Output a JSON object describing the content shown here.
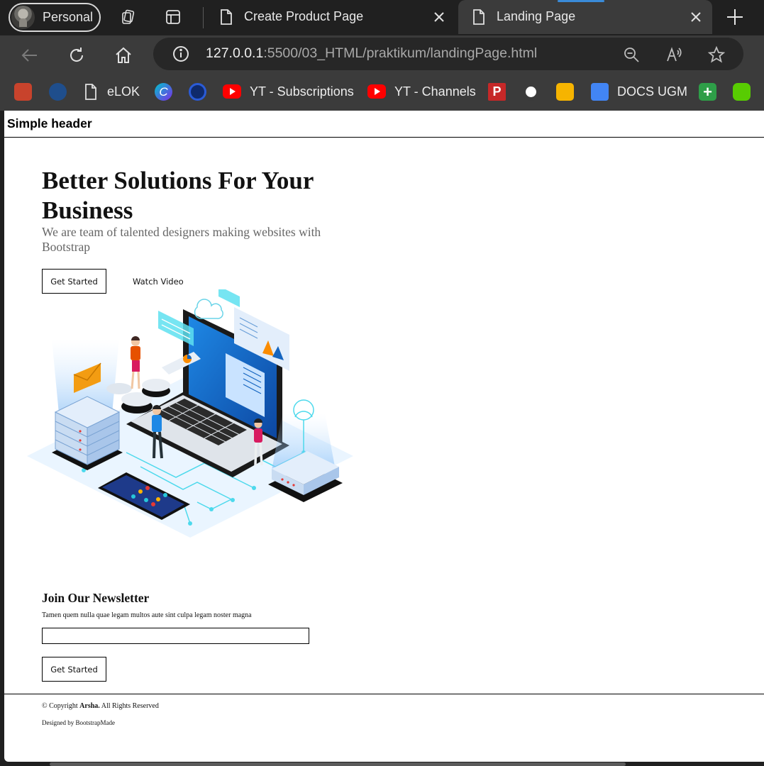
{
  "browser": {
    "profile_label": "Personal",
    "tabs": [
      {
        "title": "Create Product Page",
        "active": false
      },
      {
        "title": "Landing Page",
        "active": true
      }
    ],
    "url_host": "127.0.0.1",
    "url_rest": ":5500/03_HTML/praktikum/landingPage.html",
    "bookmarks": [
      {
        "label": "",
        "icon": "crest-icon",
        "color": "#c8432c"
      },
      {
        "label": "",
        "icon": "gear-badge-icon",
        "color": "#1f4e8c"
      },
      {
        "label": "eLOK",
        "icon": "document-icon",
        "color": "#3b3b3b"
      },
      {
        "label": "",
        "icon": "canva-icon",
        "color": "#7d2ae8"
      },
      {
        "label": "",
        "icon": "fingerprint-icon",
        "color": "#2a5bd7"
      },
      {
        "label": "YT - Subscriptions",
        "icon": "youtube-icon",
        "color": "#ff0000"
      },
      {
        "label": "YT - Channels",
        "icon": "youtube-icon",
        "color": "#ff0000"
      },
      {
        "label": "",
        "icon": "p-logo-icon",
        "color": "#c62828"
      },
      {
        "label": "",
        "icon": "github-icon",
        "color": "#ffffff"
      },
      {
        "label": "",
        "icon": "keep-bulb-icon",
        "color": "#f6b400"
      },
      {
        "label": "DOCS UGM",
        "icon": "google-docs-icon",
        "color": "#4285f4"
      },
      {
        "label": "",
        "icon": "plus-tile-icon",
        "color": "#2e9e48"
      },
      {
        "label": "",
        "icon": "duolingo-icon",
        "color": "#58cc02"
      }
    ]
  },
  "page": {
    "header_title": "Simple header",
    "hero": {
      "title": "Better Solutions For Your Business",
      "subtitle": "We are team of talented designers making websites with Bootstrap",
      "primary_button": "Get Started",
      "secondary_link": "Watch Video",
      "illustration_icon": "isometric-tech-illustration"
    },
    "newsletter": {
      "title": "Join Our Newsletter",
      "text": "Tamen quem nulla quae legam multos aute sint culpa legam noster magna",
      "input_value": "",
      "button": "Get Started"
    },
    "footer": {
      "copyright_prefix": "© Copyright",
      "brand": "Arsha.",
      "copyright_suffix": "All Rights Reserved",
      "designed_by": "Designed by BootstrapMade"
    }
  }
}
